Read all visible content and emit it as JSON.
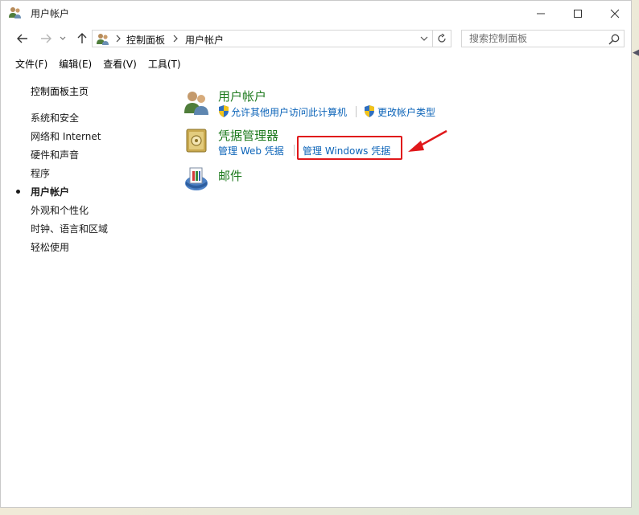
{
  "window": {
    "title": "用户帐户"
  },
  "nav": {
    "breadcrumb": [
      "控制面板",
      "用户帐户"
    ]
  },
  "search": {
    "placeholder": "搜索控制面板"
  },
  "menu": [
    "文件(F)",
    "编辑(E)",
    "查看(V)",
    "工具(T)"
  ],
  "sidebar": {
    "home": "控制面板主页",
    "items": [
      {
        "label": "系统和安全",
        "active": false
      },
      {
        "label": "网络和 Internet",
        "active": false
      },
      {
        "label": "硬件和声音",
        "active": false
      },
      {
        "label": "程序",
        "active": false
      },
      {
        "label": "用户帐户",
        "active": true
      },
      {
        "label": "外观和个性化",
        "active": false
      },
      {
        "label": "时钟、语言和区域",
        "active": false
      },
      {
        "label": "轻松使用",
        "active": false
      }
    ]
  },
  "main": {
    "categories": [
      {
        "title": "用户帐户",
        "icon": "users-icon",
        "tasks": [
          "允许其他用户访问此计算机",
          "更改帐户类型"
        ]
      },
      {
        "title": "凭据管理器",
        "icon": "vault-icon",
        "tasks": [
          "管理 Web 凭据",
          "管理 Windows 凭据"
        ]
      },
      {
        "title": "邮件",
        "icon": "mail-icon",
        "tasks": []
      }
    ]
  },
  "annotation": {
    "color": "#e0181b"
  },
  "colors": {
    "category_title": "#1e7a1e",
    "link": "#0b63b8"
  }
}
